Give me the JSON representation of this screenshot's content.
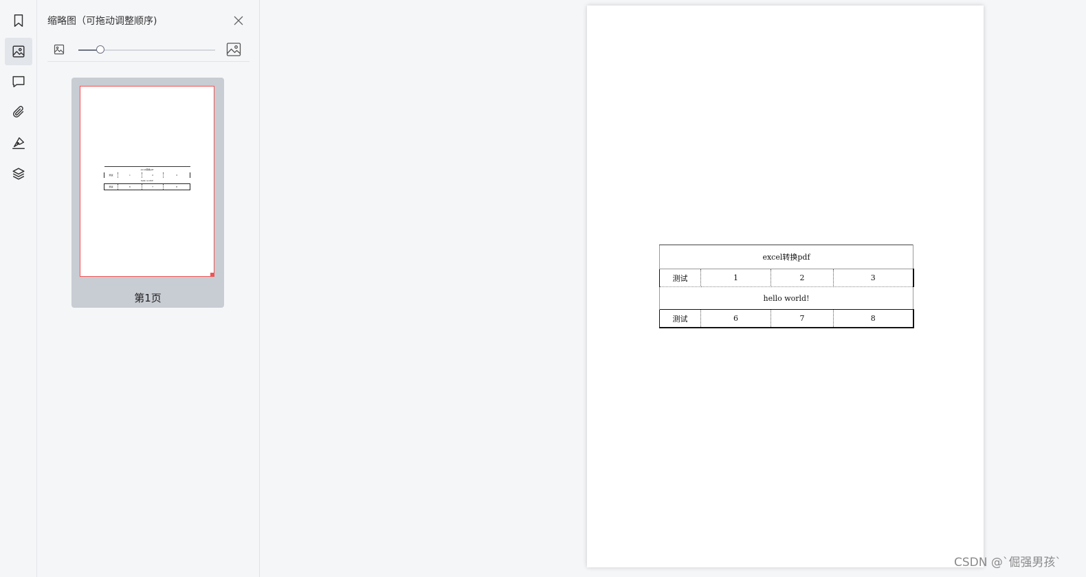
{
  "sidebar": {
    "icons": [
      "bookmark-icon",
      "thumbnail-icon",
      "comment-icon",
      "attachment-icon",
      "signature-icon",
      "layers-icon"
    ],
    "active": "thumbnail-icon"
  },
  "thumbnail_panel": {
    "title": "缩略图（可拖动调整顺序)",
    "zoom_fraction": 0.16,
    "pages": [
      {
        "label": "第1页",
        "selected": true
      }
    ]
  },
  "document": {
    "table": {
      "title": "excel转换pdf",
      "row1": [
        "测试",
        "1",
        "2",
        "3"
      ],
      "merged": "hello world!",
      "row2": [
        "测试",
        "6",
        "7",
        "8"
      ]
    }
  },
  "watermark": "CSDN @`倔强男孩`",
  "colors": {
    "accent_red": "#f05454",
    "panel_bg": "#f5f6f8",
    "card_selected": "#c8ccd3"
  }
}
